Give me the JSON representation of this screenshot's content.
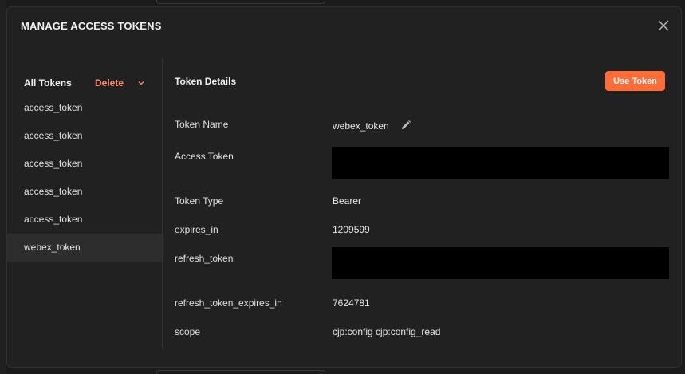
{
  "modal": {
    "title": "MANAGE ACCESS TOKENS"
  },
  "sidebar": {
    "header_label": "All Tokens",
    "delete_label": "Delete",
    "tokens": [
      "access_token",
      "access_token",
      "access_token",
      "access_token",
      "access_token",
      "webex_token"
    ],
    "selected_token": "webex_token"
  },
  "details": {
    "title": "Token Details",
    "use_token_label": "Use Token",
    "rows": {
      "token_name": {
        "label": "Token Name",
        "value": "webex_token"
      },
      "access_token": {
        "label": "Access Token",
        "value": ""
      },
      "token_type": {
        "label": "Token Type",
        "value": "Bearer"
      },
      "expires_in": {
        "label": "expires_in",
        "value": "1209599"
      },
      "refresh_token": {
        "label": "refresh_token",
        "value": ""
      },
      "refresh_token_expires_in": {
        "label": "refresh_token_expires_in",
        "value": "7624781"
      },
      "scope": {
        "label": "scope",
        "value": "cjp:config cjp:config_read"
      }
    }
  },
  "colors": {
    "accent": "#ff6c37",
    "delete": "#ff8e6a",
    "modal_bg": "#212121"
  },
  "icons": {
    "close": "close-icon",
    "chevron": "chevron-down-icon",
    "edit": "pencil-icon"
  }
}
